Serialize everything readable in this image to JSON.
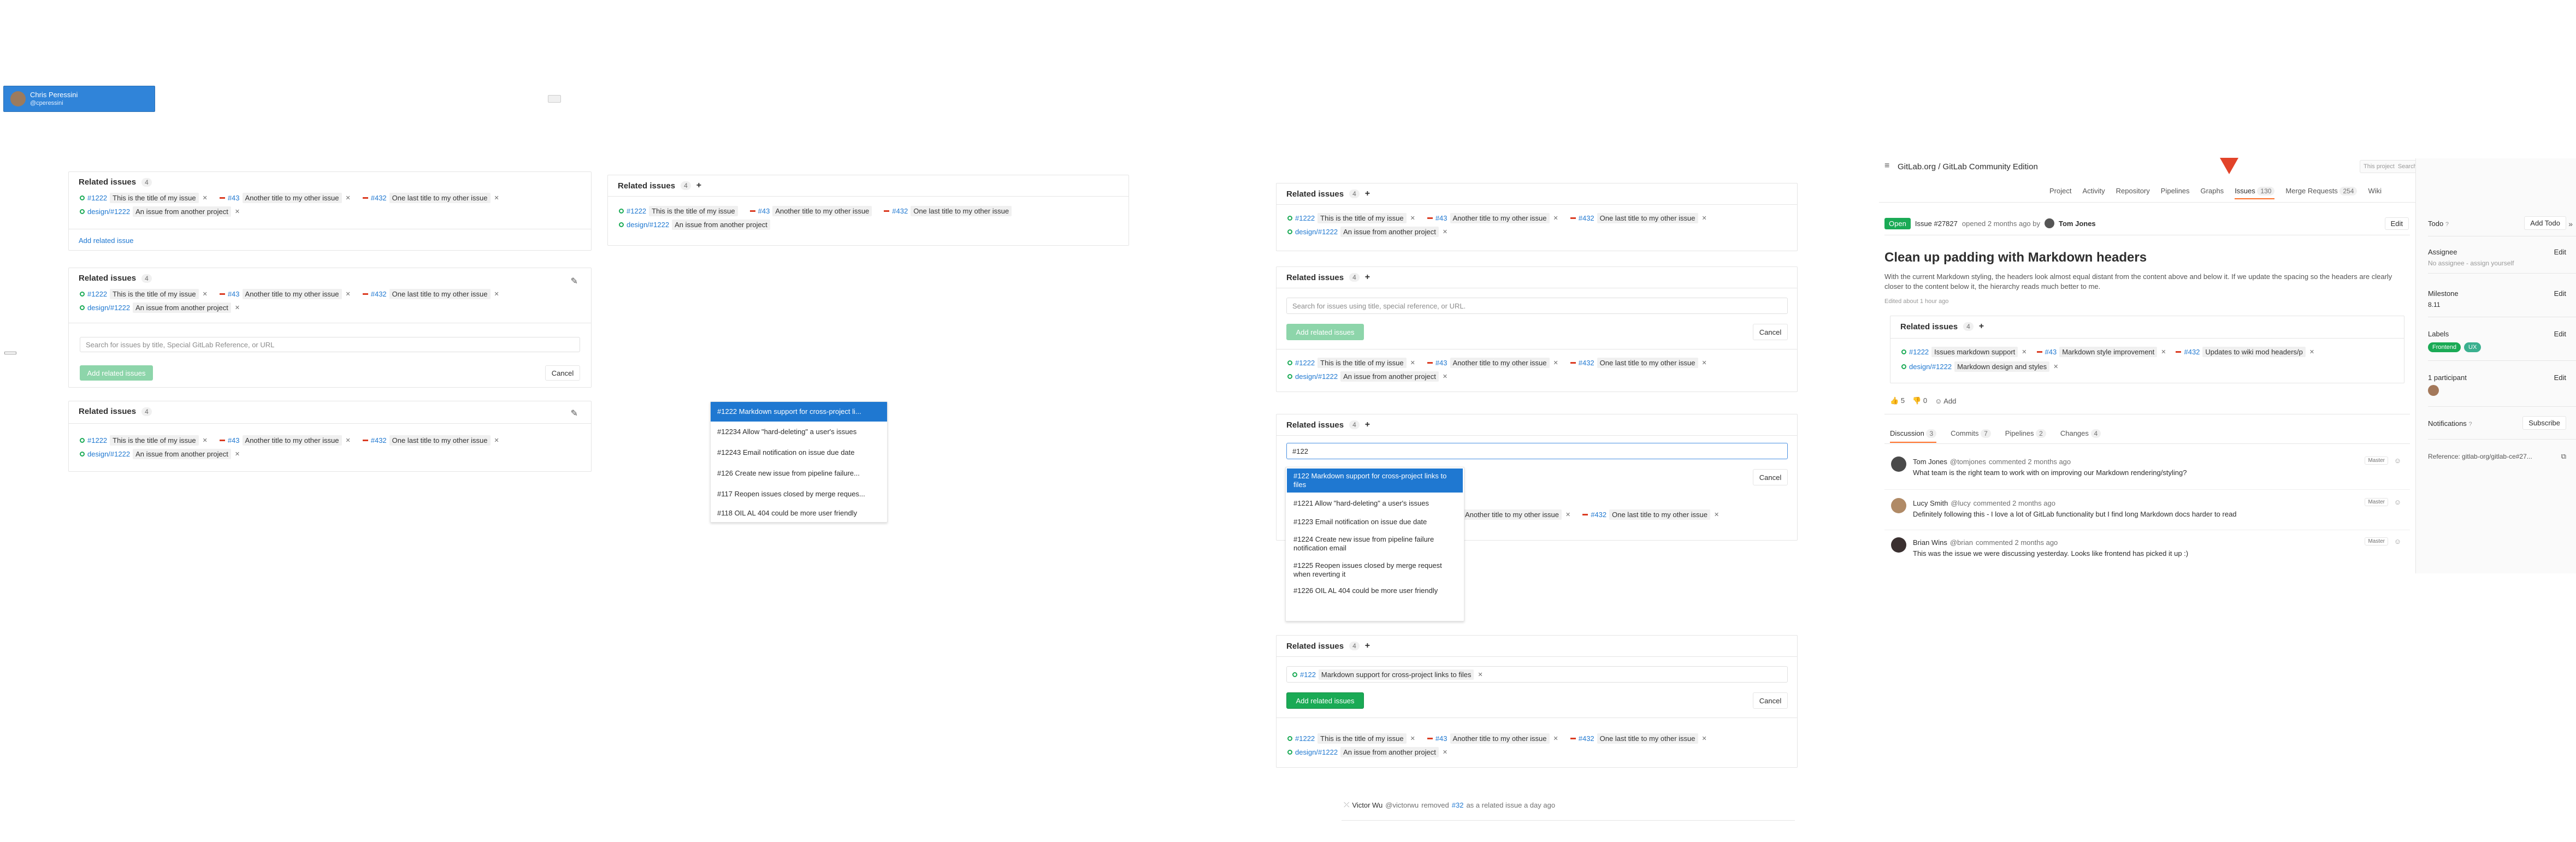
{
  "user_card": {
    "name": "Chris Peressini",
    "handle": "@cperessini"
  },
  "panel_title": "Related issues",
  "count": "4",
  "count_small": "4",
  "tokens_main": [
    {
      "ref": "#1222",
      "state": "open",
      "title": "This is the title of my issue"
    },
    {
      "ref": "#43",
      "state": "closed",
      "title": "Another title to my other issue"
    },
    {
      "ref": "#432",
      "state": "closed",
      "title": "One last title to my other issue"
    },
    {
      "ref": "design/#1222",
      "state": "open",
      "title": "An issue from another project"
    }
  ],
  "add_related_link": "Add related issue",
  "search_placeholder_a": "Search for issues by title, Special GitLab Reference, or URL",
  "search_placeholder_b": "Search for issues using title, special reference, or URL.",
  "btn_add": "Add related issues",
  "btn_cancel": "Cancel",
  "dropdown_left": [
    "#1222 Markdown support for cross-project li...",
    "#12234 Allow \"hard-deleting\" a user's issues",
    "#12243 Email notification on issue due date",
    "#126 Create new issue from pipeline failure...",
    "#117 Reopen issues closed by merge reques...",
    "#118 OIL AL 404 could be more user friendly"
  ],
  "query_value": "#122",
  "dropdown_mid": [
    "#122 Markdown support for cross-project links to files",
    "#1221 Allow \"hard-deleting\" a user's issues",
    "#1223 Email notification on issue due date",
    "#1224 Create new issue from pipeline failure notification email",
    "#1225 Reopen issues closed by merge request when reverting it",
    "#1226 OIL AL 404 could be more user friendly"
  ],
  "pending_token": {
    "ref": "#122",
    "title": "Markdown support for cross-project links to files"
  },
  "activity": {
    "user": "Victor Wu",
    "handle": "@victorwu",
    "text_pre": "removed",
    "ref": "#32",
    "text_post": "as a related issue a day ago"
  },
  "app": {
    "breadcrumb": "GitLab.org / GitLab Community Edition",
    "search_scope": "This project",
    "search_placeholder": "Search",
    "nav": [
      "Project",
      "Activity",
      "Repository",
      "Pipelines",
      "Graphs",
      "Issues",
      "Merge Requests",
      "Wiki"
    ],
    "issues_count": "130",
    "mr_count": "254",
    "status": "Open",
    "issue_ref": "Issue #27827",
    "opened_text": "opened 2 months ago by",
    "author": "Tom Jones",
    "edit": "Edit",
    "title": "Clean up padding with Markdown headers",
    "description": "With the current Markdown styling, the headers look almost equal distant from the content above and below it. If we update the spacing so the headers are clearly closer to the content below it, the hierarchy reads much better to me.",
    "edited": "Edited about 1 hour ago",
    "related_tokens": [
      {
        "ref": "#1222",
        "state": "open",
        "title": "Issues markdown support"
      },
      {
        "ref": "#43",
        "state": "closed",
        "title": "Markdown style improvement"
      },
      {
        "ref": "#432",
        "state": "closed",
        "title": "Updates to wiki mod headers/p"
      },
      {
        "ref": "design/#1222",
        "state": "open",
        "title": "Markdown design and styles"
      }
    ],
    "thumbs_up": "5",
    "thumbs_down": "0",
    "add_reaction": "Add",
    "tabs": [
      {
        "label": "Discussion",
        "count": "3"
      },
      {
        "label": "Commits",
        "count": "7"
      },
      {
        "label": "Pipelines",
        "count": "2"
      },
      {
        "label": "Changes",
        "count": "4"
      }
    ],
    "comments": [
      {
        "name": "Tom Jones",
        "handle": "@tomjones",
        "meta": "commented 2 months ago",
        "badge": "Master",
        "text": "What team is the right team to work with on improving our Markdown rendering/styling?"
      },
      {
        "name": "Lucy Smith",
        "handle": "@lucy",
        "meta": "commented 2 months ago",
        "badge": "Master",
        "text": "Definitely following this - I love a lot of GitLab functionality but I find long Markdown docs harder to read"
      },
      {
        "name": "Brian Wins",
        "handle": "@brian",
        "meta": "commented 2 months ago",
        "badge": "Master",
        "text": "This was the issue we were discussing yesterday. Looks like frontend has picked it up :)"
      }
    ],
    "sidebar": {
      "todo": "Todo",
      "add_todo": "Add Todo",
      "assignee": "Assignee",
      "assignee_value": "No assignee - assign yourself",
      "milestone": "Milestone",
      "milestone_value": "8.11",
      "labels": "Labels",
      "label_1": "Frontend",
      "label_2": "UX",
      "participants": "1 participant",
      "notifications": "Notifications",
      "subscribe": "Subscribe",
      "reference": "Reference: gitlab-org/gitlab-ce#27...",
      "edit": "Edit"
    },
    "colors": {
      "open": "#1aaa55",
      "accent": "#1f78d1",
      "label_frontend": "#1aaa55"
    }
  }
}
